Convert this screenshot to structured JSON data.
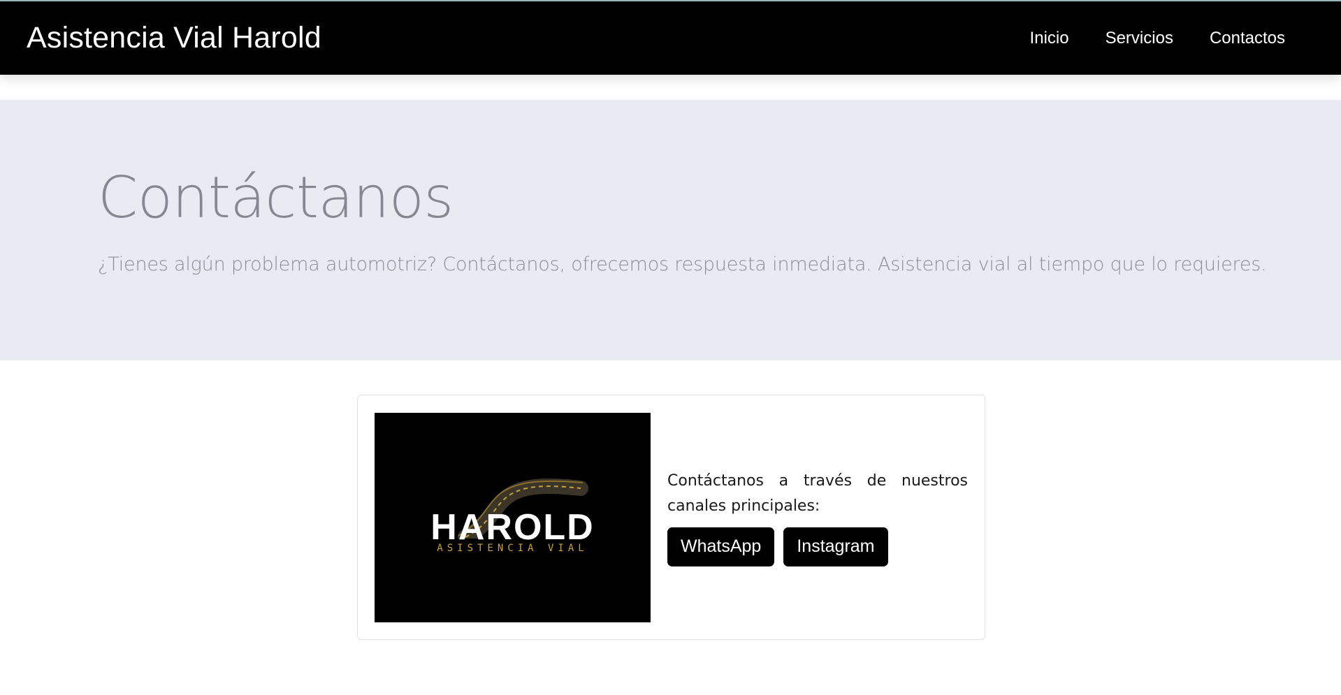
{
  "navbar": {
    "brand": "Asistencia Vial Harold",
    "links": [
      "Inicio",
      "Servicios",
      "Contactos"
    ]
  },
  "hero": {
    "title": "Contáctanos",
    "subtitle": "¿Tienes algún problema automotriz? Contáctanos, ofrecemos respuesta inmediata. Asistencia vial al tiempo que lo requieres."
  },
  "contact_card": {
    "logo": {
      "wordmark": "HAROLD",
      "tagline": "ASISTENCIA VIAL",
      "icon": "road-icon"
    },
    "text": "Contáctanos a través de nuestros canales principales:",
    "buttons": [
      "WhatsApp",
      "Instagram"
    ]
  },
  "colors": {
    "navbar_bg": "#000000",
    "hero_bg": "#e9ebf3",
    "hero_text": "#868793",
    "logo_accent": "#c9a13a",
    "button_bg": "#000000"
  }
}
